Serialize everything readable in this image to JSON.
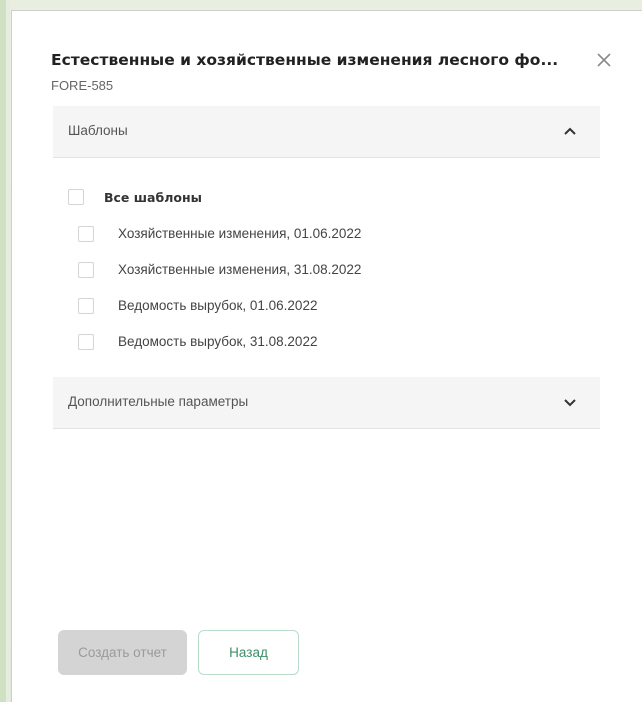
{
  "dialog": {
    "title": "Естественные и хозяйственные изменения лесного фо...",
    "subtitle": "FORE-585",
    "close_icon": "close-icon"
  },
  "templates_section": {
    "label": "Шаблоны",
    "expanded": true,
    "all_label": "Все шаблоны",
    "items": [
      {
        "label": "Хозяйственные изменения, 01.06.2022",
        "checked": false
      },
      {
        "label": "Хозяйственные изменения, 31.08.2022",
        "checked": false
      },
      {
        "label": "Ведомость вырубок, 01.06.2022",
        "checked": false
      },
      {
        "label": "Ведомость вырубок, 31.08.2022",
        "checked": false
      }
    ]
  },
  "extra_section": {
    "label": "Дополнительные параметры",
    "expanded": false
  },
  "buttons": {
    "create_label": "Создать отчет",
    "back_label": "Назад"
  },
  "colors": {
    "accent": "#3c8f6a",
    "disabled_bg": "#d4d4d4"
  }
}
